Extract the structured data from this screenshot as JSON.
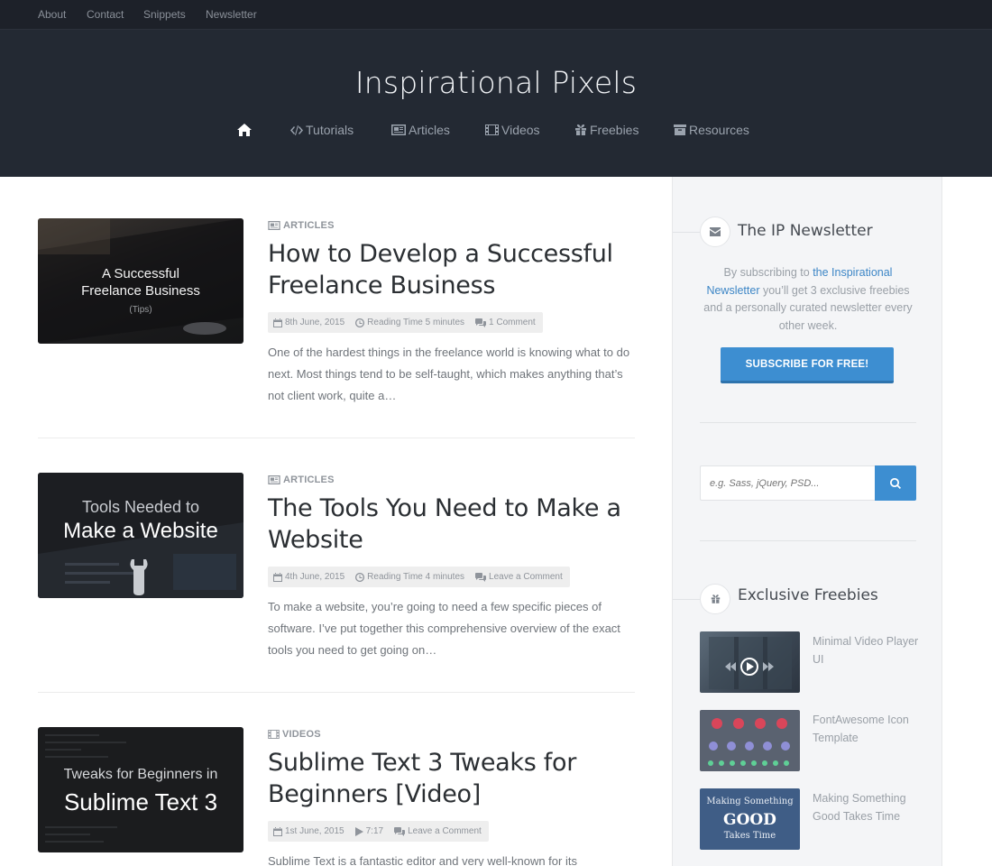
{
  "topnav": {
    "links": [
      "About",
      "Contact",
      "Snippets",
      "Newsletter"
    ]
  },
  "site": {
    "title": "Inspirational Pixels"
  },
  "mainnav": {
    "items": [
      {
        "label": "",
        "icon": "home-icon"
      },
      {
        "label": "Tutorials",
        "icon": "code-icon"
      },
      {
        "label": "Articles",
        "icon": "newspaper-icon"
      },
      {
        "label": "Videos",
        "icon": "film-icon"
      },
      {
        "label": "Freebies",
        "icon": "gift-icon"
      },
      {
        "label": "Resources",
        "icon": "archive-icon"
      }
    ]
  },
  "posts": [
    {
      "category": "ARTICLES",
      "category_icon": "newspaper-icon",
      "title": "How to Develop a Successful Freelance Business",
      "thumb_line1": "A Successful",
      "thumb_line2": "Freelance Business",
      "thumb_line3": "(Tips)",
      "date": "8th June, 2015",
      "info": "Reading Time 5 minutes",
      "comments": "1 Comment",
      "excerpt": "One of the hardest things in the freelance world is knowing what to do next. Most things tend to be self-taught, which makes anything that’s not client work, quite a…"
    },
    {
      "category": "ARTICLES",
      "category_icon": "newspaper-icon",
      "title": "The Tools You Need to Make a Website",
      "thumb_line1": "Tools Needed to",
      "thumb_line2": "Make a Website",
      "date": "4th June, 2015",
      "info": "Reading Time 4 minutes",
      "comments": "Leave a Comment",
      "excerpt": "To make a website, you’re going to need a few specific pieces of software. I’ve put together this comprehensive overview of the exact tools you need to get going on…"
    },
    {
      "category": "VIDEOS",
      "category_icon": "film-icon",
      "title": "Sublime Text 3 Tweaks for Beginners [Video]",
      "thumb_line1": "Tweaks for Beginners in",
      "thumb_line2": "Sublime Text 3",
      "date": "1st June, 2015",
      "info": "7:17",
      "comments": "Leave a Comment",
      "excerpt": "Sublime Text is a fantastic editor and very well-known for its"
    }
  ],
  "sidebar": {
    "newsletter": {
      "heading": "The IP Newsletter",
      "text_before": "By subscribing to ",
      "link_text": "the Inspirational Newsletter",
      "text_after": " you’ll get 3 exclusive freebies and a personally curated newsletter every other week.",
      "button": "SUBSCRIBE FOR FREE!"
    },
    "search": {
      "placeholder": "e.g. Sass, jQuery, PSD..."
    },
    "freebies": {
      "heading": "Exclusive Freebies",
      "items": [
        {
          "title": "Minimal Video Player UI"
        },
        {
          "title": "FontAwesome Icon Template"
        },
        {
          "title": "Making Something Good Takes Time",
          "thumb_top": "Making Something",
          "thumb_mid": "GOOD",
          "thumb_bottom": "Takes Time"
        }
      ]
    }
  },
  "colors": {
    "topbar": "#1d2129",
    "header": "#232933",
    "accent": "#3d8ed1",
    "sidebar": "#f4f5f7"
  }
}
